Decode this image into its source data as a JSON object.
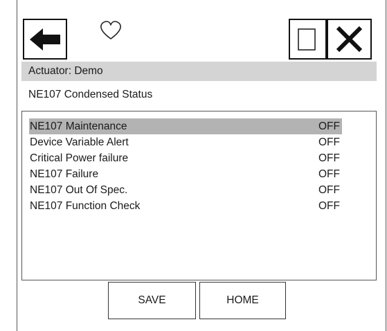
{
  "header": {
    "title": "Actuator: Demo"
  },
  "subtitle": "NE107 Condensed Status",
  "icons": {
    "back": "back-arrow-icon",
    "favorite": "heart-icon",
    "blank": "blank-rectangle-icon",
    "close": "close-x-icon"
  },
  "status_list": {
    "selected_index": 0,
    "rows": [
      {
        "label": "NE107 Maintenance",
        "value": "OFF"
      },
      {
        "label": "Device Variable Alert",
        "value": "OFF"
      },
      {
        "label": "Critical Power failure",
        "value": "OFF"
      },
      {
        "label": "NE107 Failure",
        "value": "OFF"
      },
      {
        "label": "NE107 Out Of Spec.",
        "value": "OFF"
      },
      {
        "label": "NE107 Function Check",
        "value": "OFF"
      }
    ]
  },
  "buttons": {
    "save_label": "SAVE",
    "home_label": "HOME"
  },
  "colors": {
    "header_bg": "#d4d4d4",
    "selected_row_bg": "#b3b3b3",
    "border": "#111111"
  }
}
